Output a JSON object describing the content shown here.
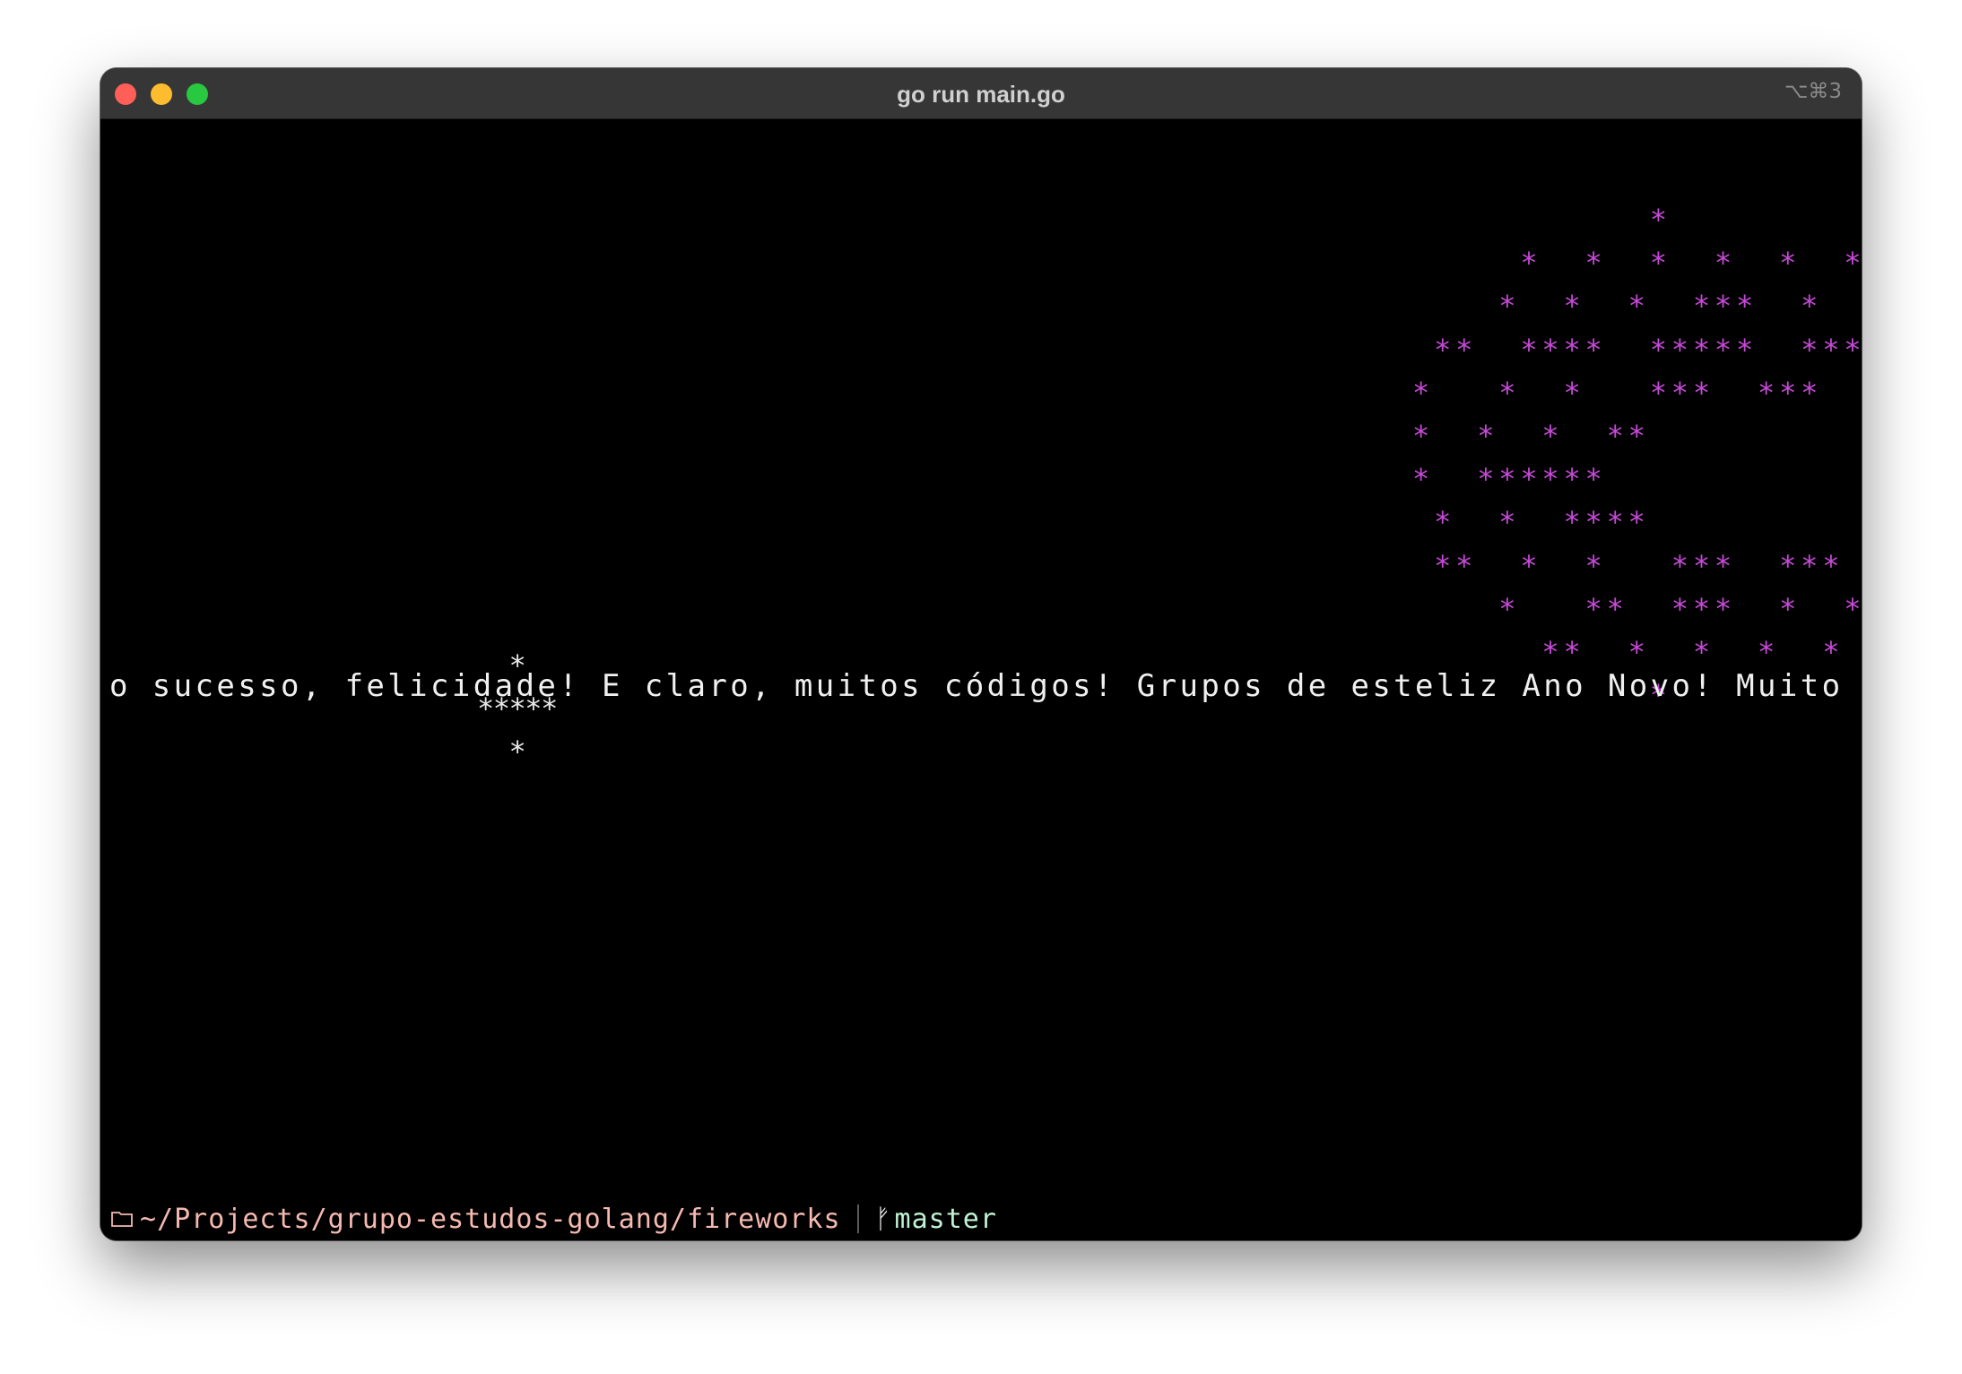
{
  "window": {
    "title": "go run main.go",
    "shortcut": "⌥⌘3"
  },
  "colors": {
    "firework_pink": "#c54ad6",
    "firework_white": "#e8e8e8",
    "message_text": "#f0f0f0",
    "path_text": "#f5b9b0",
    "branch_text": "#bff2d2",
    "close": "#ff5f57",
    "minimize": "#febc2e",
    "zoom": "#28c840"
  },
  "terminal": {
    "scrolling_message": "o sucesso, felicidade! E claro, muitos códigos! Grupos de esteliz Ano Novo! Muito",
    "firework_large": [
      "           *",
      "     *  *  *  *  *  *  *",
      "    *  *  *  ***  *  *  *",
      " **  ****  *****  ****  **",
      "*   *  *   ***  ***   *  *   *",
      "*  *  *  **          **  *  *  *",
      "*  ******             ******  *",
      " *  *  ****          ****  *  *",
      " **  *  *   ***  ***   *  *  **",
      "    *   **  ***  *  *  *",
      "      **  *  *  *  *  *",
      "           *"
    ],
    "firework_small": [
      "  *",
      "*****",
      "  *"
    ]
  },
  "prompt": {
    "folder_icon": "folder-icon",
    "path": "~/Projects/grupo-estudos-golang/fireworks",
    "branch_icon": "git-branch-icon",
    "branch": "master"
  }
}
